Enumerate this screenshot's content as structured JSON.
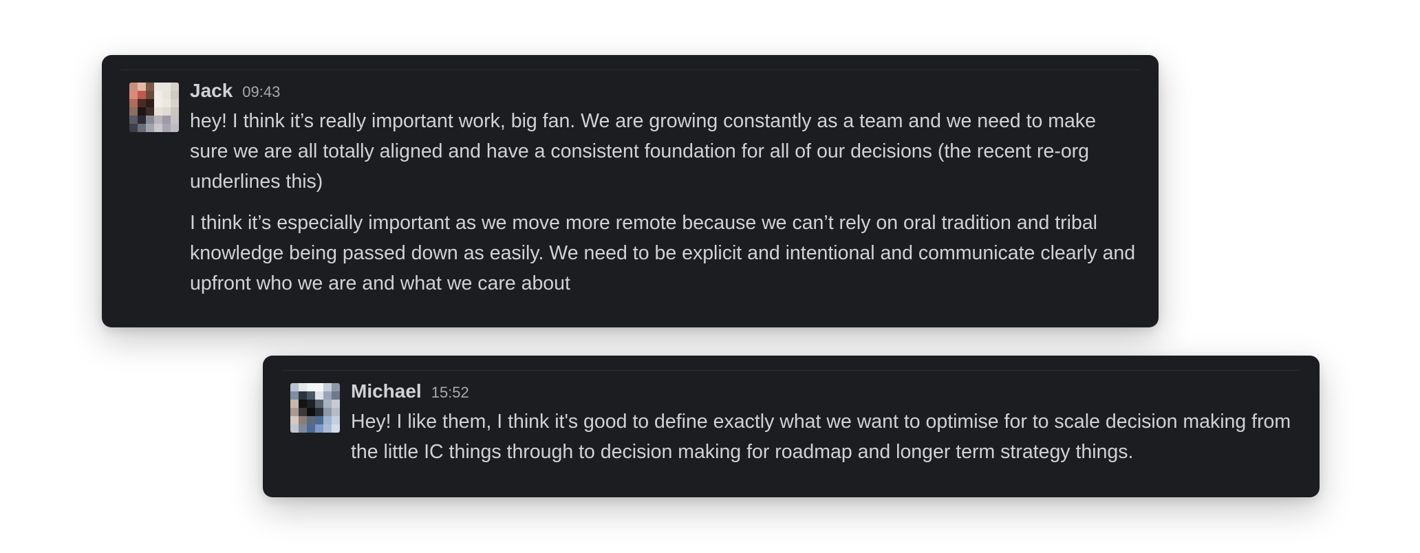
{
  "messages": [
    {
      "author": "Jack",
      "time": "09:43",
      "paragraphs": [
        "hey! I think it’s really important work, big fan. We are growing constantly as a team and we need to make sure we are all totally aligned and have a consistent foundation for all of our decisions (the recent re-org underlines this)",
        "I think it’s especially important as we move more remote because we can’t rely on oral tradition and tribal knowledge being passed down as easily. We need to be explicit and intentional and communicate clearly and upfront who we are and what we care about"
      ],
      "avatar_colors": [
        "#c98f7d",
        "#e2b9a6",
        "#7b5a4a",
        "#eae7e0",
        "#e9e6df",
        "#d6d2c8",
        "#d98a7a",
        "#c05a4c",
        "#6a4a3c",
        "#f0ede6",
        "#e8e4dc",
        "#cfcac0",
        "#b06b5d",
        "#4a2a22",
        "#2d1d18",
        "#f1eee8",
        "#ece8e1",
        "#d8d3ca",
        "#8c6d64",
        "#1f1614",
        "#3a2d2a",
        "#e6e2da",
        "#e0dbd2",
        "#cbc5bb",
        "#5a5a66",
        "#2a2a33",
        "#8a8a96",
        "#b7b4bb",
        "#9d9aa4",
        "#c6c2c6",
        "#3e3f4a",
        "#6b6d7a",
        "#a3a3ad",
        "#c9c6cc",
        "#a8a6b0",
        "#bebbc2"
      ]
    },
    {
      "author": "Michael",
      "time": "15:52",
      "paragraphs": [
        "Hey! I like them, I think it's good to define exactly what we want to optimise for to scale decision making from the little IC things through to decision making for roadmap and longer term strategy things."
      ],
      "avatar_colors": [
        "#b9c2cf",
        "#e4e6ea",
        "#f2f3f5",
        "#f4f5f7",
        "#c8ced8",
        "#8e98a8",
        "#7f8da3",
        "#2c3440",
        "#4a5566",
        "#dfe2e7",
        "#9aa5b6",
        "#6d7a8e",
        "#c6b7ac",
        "#141414",
        "#1e2228",
        "#56606d",
        "#a9b2c0",
        "#c7ccd4",
        "#a99a92",
        "#3b3a3b",
        "#0f0f10",
        "#2b2f35",
        "#8f98a6",
        "#b6bcc6",
        "#d4c8c0",
        "#8a7e79",
        "#5e6a79",
        "#4e6a92",
        "#9eb3d0",
        "#c3cfe0",
        "#bfc6cf",
        "#7d8a9a",
        "#4d6b94",
        "#7f9bc3",
        "#a9bbd6",
        "#d4dce8"
      ]
    }
  ]
}
